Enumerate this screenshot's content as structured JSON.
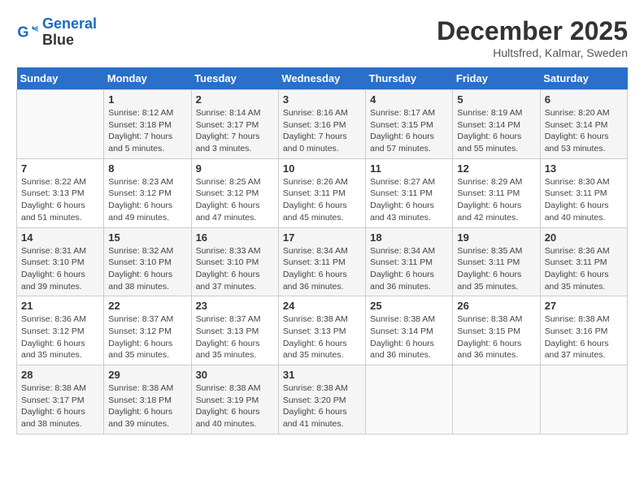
{
  "logo": {
    "line1": "General",
    "line2": "Blue"
  },
  "title": "December 2025",
  "subtitle": "Hultsfred, Kalmar, Sweden",
  "days_of_week": [
    "Sunday",
    "Monday",
    "Tuesday",
    "Wednesday",
    "Thursday",
    "Friday",
    "Saturday"
  ],
  "weeks": [
    [
      {
        "day": "",
        "info": ""
      },
      {
        "day": "1",
        "info": "Sunrise: 8:12 AM\nSunset: 3:18 PM\nDaylight: 7 hours\nand 5 minutes."
      },
      {
        "day": "2",
        "info": "Sunrise: 8:14 AM\nSunset: 3:17 PM\nDaylight: 7 hours\nand 3 minutes."
      },
      {
        "day": "3",
        "info": "Sunrise: 8:16 AM\nSunset: 3:16 PM\nDaylight: 7 hours\nand 0 minutes."
      },
      {
        "day": "4",
        "info": "Sunrise: 8:17 AM\nSunset: 3:15 PM\nDaylight: 6 hours\nand 57 minutes."
      },
      {
        "day": "5",
        "info": "Sunrise: 8:19 AM\nSunset: 3:14 PM\nDaylight: 6 hours\nand 55 minutes."
      },
      {
        "day": "6",
        "info": "Sunrise: 8:20 AM\nSunset: 3:14 PM\nDaylight: 6 hours\nand 53 minutes."
      }
    ],
    [
      {
        "day": "7",
        "info": "Sunrise: 8:22 AM\nSunset: 3:13 PM\nDaylight: 6 hours\nand 51 minutes."
      },
      {
        "day": "8",
        "info": "Sunrise: 8:23 AM\nSunset: 3:12 PM\nDaylight: 6 hours\nand 49 minutes."
      },
      {
        "day": "9",
        "info": "Sunrise: 8:25 AM\nSunset: 3:12 PM\nDaylight: 6 hours\nand 47 minutes."
      },
      {
        "day": "10",
        "info": "Sunrise: 8:26 AM\nSunset: 3:11 PM\nDaylight: 6 hours\nand 45 minutes."
      },
      {
        "day": "11",
        "info": "Sunrise: 8:27 AM\nSunset: 3:11 PM\nDaylight: 6 hours\nand 43 minutes."
      },
      {
        "day": "12",
        "info": "Sunrise: 8:29 AM\nSunset: 3:11 PM\nDaylight: 6 hours\nand 42 minutes."
      },
      {
        "day": "13",
        "info": "Sunrise: 8:30 AM\nSunset: 3:11 PM\nDaylight: 6 hours\nand 40 minutes."
      }
    ],
    [
      {
        "day": "14",
        "info": "Sunrise: 8:31 AM\nSunset: 3:10 PM\nDaylight: 6 hours\nand 39 minutes."
      },
      {
        "day": "15",
        "info": "Sunrise: 8:32 AM\nSunset: 3:10 PM\nDaylight: 6 hours\nand 38 minutes."
      },
      {
        "day": "16",
        "info": "Sunrise: 8:33 AM\nSunset: 3:10 PM\nDaylight: 6 hours\nand 37 minutes."
      },
      {
        "day": "17",
        "info": "Sunrise: 8:34 AM\nSunset: 3:11 PM\nDaylight: 6 hours\nand 36 minutes."
      },
      {
        "day": "18",
        "info": "Sunrise: 8:34 AM\nSunset: 3:11 PM\nDaylight: 6 hours\nand 36 minutes."
      },
      {
        "day": "19",
        "info": "Sunrise: 8:35 AM\nSunset: 3:11 PM\nDaylight: 6 hours\nand 35 minutes."
      },
      {
        "day": "20",
        "info": "Sunrise: 8:36 AM\nSunset: 3:11 PM\nDaylight: 6 hours\nand 35 minutes."
      }
    ],
    [
      {
        "day": "21",
        "info": "Sunrise: 8:36 AM\nSunset: 3:12 PM\nDaylight: 6 hours\nand 35 minutes."
      },
      {
        "day": "22",
        "info": "Sunrise: 8:37 AM\nSunset: 3:12 PM\nDaylight: 6 hours\nand 35 minutes."
      },
      {
        "day": "23",
        "info": "Sunrise: 8:37 AM\nSunset: 3:13 PM\nDaylight: 6 hours\nand 35 minutes."
      },
      {
        "day": "24",
        "info": "Sunrise: 8:38 AM\nSunset: 3:13 PM\nDaylight: 6 hours\nand 35 minutes."
      },
      {
        "day": "25",
        "info": "Sunrise: 8:38 AM\nSunset: 3:14 PM\nDaylight: 6 hours\nand 36 minutes."
      },
      {
        "day": "26",
        "info": "Sunrise: 8:38 AM\nSunset: 3:15 PM\nDaylight: 6 hours\nand 36 minutes."
      },
      {
        "day": "27",
        "info": "Sunrise: 8:38 AM\nSunset: 3:16 PM\nDaylight: 6 hours\nand 37 minutes."
      }
    ],
    [
      {
        "day": "28",
        "info": "Sunrise: 8:38 AM\nSunset: 3:17 PM\nDaylight: 6 hours\nand 38 minutes."
      },
      {
        "day": "29",
        "info": "Sunrise: 8:38 AM\nSunset: 3:18 PM\nDaylight: 6 hours\nand 39 minutes."
      },
      {
        "day": "30",
        "info": "Sunrise: 8:38 AM\nSunset: 3:19 PM\nDaylight: 6 hours\nand 40 minutes."
      },
      {
        "day": "31",
        "info": "Sunrise: 8:38 AM\nSunset: 3:20 PM\nDaylight: 6 hours\nand 41 minutes."
      },
      {
        "day": "",
        "info": ""
      },
      {
        "day": "",
        "info": ""
      },
      {
        "day": "",
        "info": ""
      }
    ]
  ]
}
